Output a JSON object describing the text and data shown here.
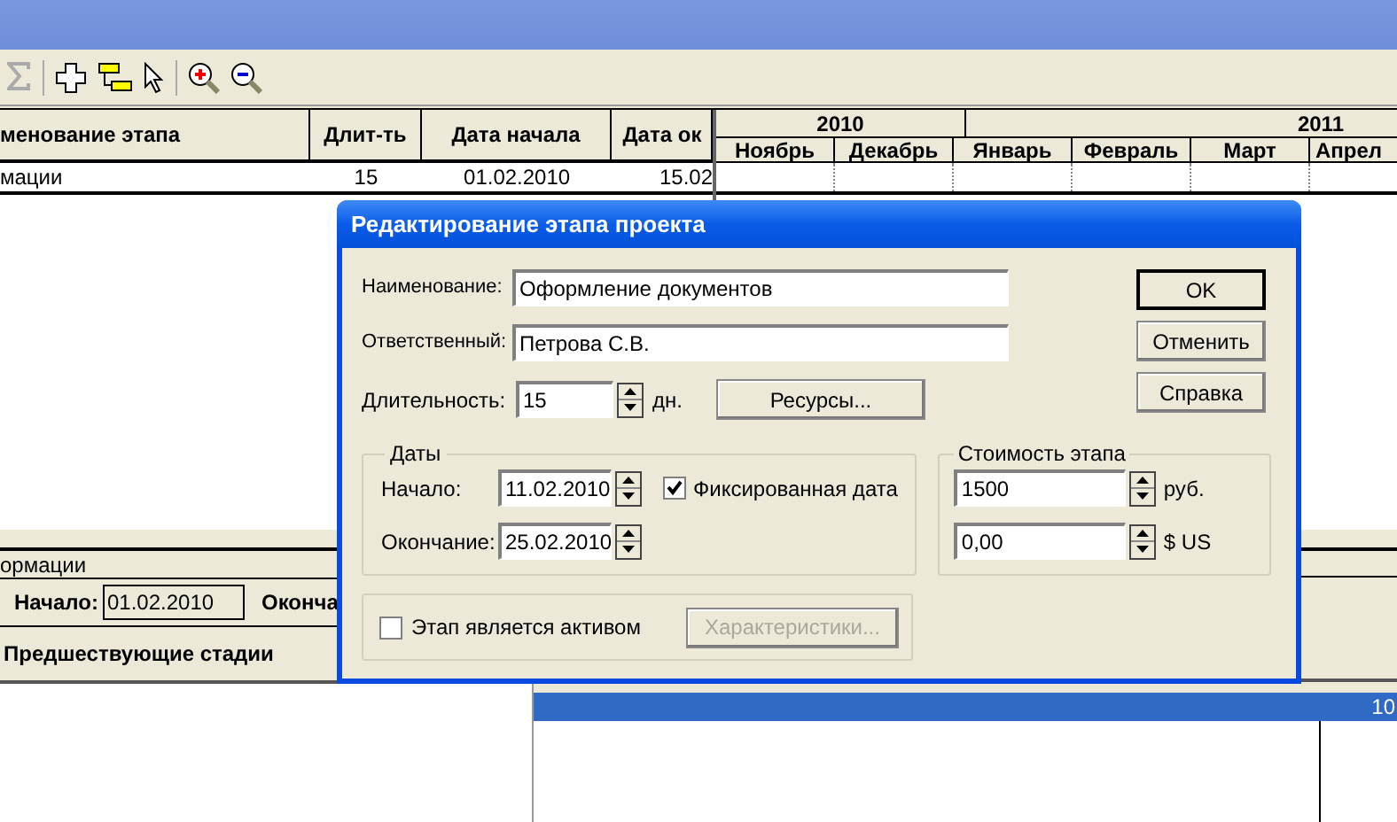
{
  "stages_table": {
    "columns": [
      "менование этапа",
      "Длит-ть",
      "Дата начала",
      "Дата ок"
    ],
    "rows": [
      [
        "мации",
        "15",
        "01.02.2010",
        "15.02"
      ]
    ]
  },
  "gantt": {
    "years": [
      "2010",
      "2011"
    ],
    "months": [
      "Ноябрь",
      "Декабрь",
      "Январь",
      "Февраль",
      "Март",
      "Апрел"
    ]
  },
  "info_panel": {
    "title": "ормации",
    "start_label": "Начало:",
    "start_value": "01.02.2010",
    "end_label": "Оконча",
    "section": "Предшествующие стадии"
  },
  "lower_grid": {
    "selected_row_value": "10"
  },
  "dialog": {
    "title": "Редактирование этапа проекта",
    "name": {
      "label": "Наименование:",
      "value": "Оформление документов"
    },
    "responsible": {
      "label": "Ответственный:",
      "value": "Петрова С.В."
    },
    "duration": {
      "label": "Длительность:",
      "value": "15",
      "unit": "дн."
    },
    "resources_button": "Ресурсы...",
    "buttons": [
      {
        "label": "OK",
        "default": true
      },
      {
        "label": "Отменить",
        "default": false
      },
      {
        "label": "Справка",
        "default": false
      }
    ],
    "dates": {
      "title": "Даты",
      "start": {
        "label": "Начало:",
        "value": "11.02.2010"
      },
      "end": {
        "label": "Окончание:",
        "value": "25.02.2010"
      },
      "fixed": {
        "label": "Фиксированная дата",
        "checked": true
      }
    },
    "cost": {
      "title": "Стоимость этапа",
      "rub": {
        "value": "1500",
        "unit": "руб."
      },
      "usd": {
        "value": "0,00",
        "unit": "$ US"
      }
    },
    "asset": {
      "label": "Этап является активом",
      "checked": false
    },
    "characteristics_button": {
      "label": "Характеристики...",
      "disabled": true
    }
  }
}
